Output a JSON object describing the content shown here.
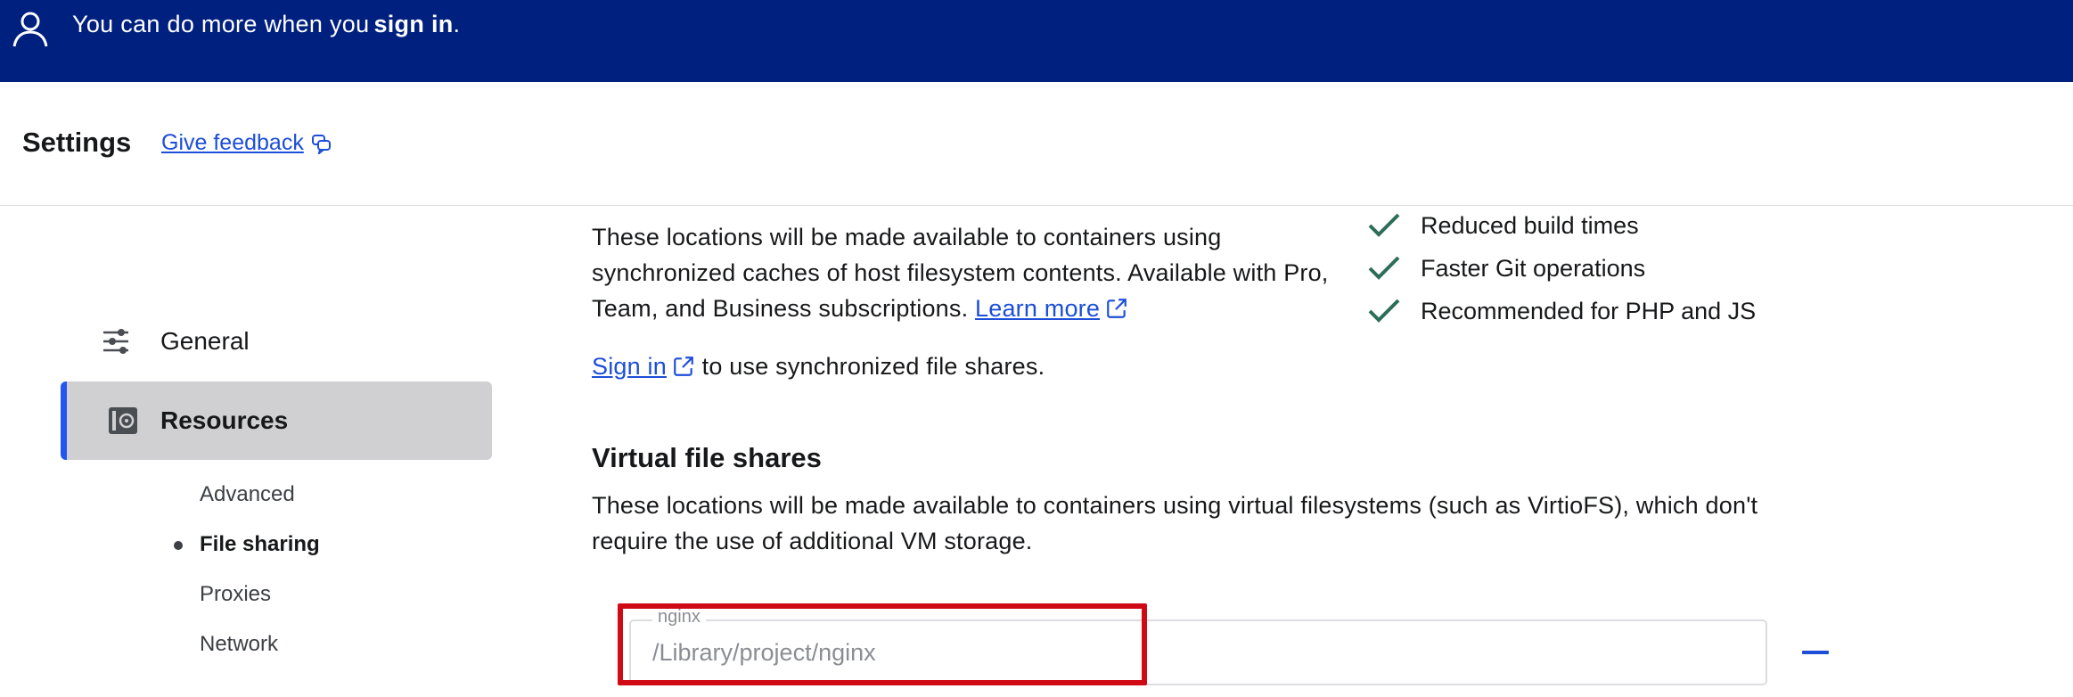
{
  "banner": {
    "message": "You can do more when you",
    "sign_in": "sign in",
    "suffix": "."
  },
  "header": {
    "title": "Settings",
    "feedback": "Give feedback"
  },
  "sidebar": {
    "items": [
      {
        "label": "General",
        "icon": "sliders-icon"
      },
      {
        "label": "Resources",
        "icon": "resources-icon",
        "active": true
      }
    ],
    "subitems": [
      {
        "label": "Advanced"
      },
      {
        "label": "File sharing",
        "active": true
      },
      {
        "label": "Proxies"
      },
      {
        "label": "Network"
      }
    ]
  },
  "synchronized": {
    "description": "These locations will be made available to containers using synchronized caches of host filesystem contents. Available with Pro, Team, and Business subscriptions.",
    "learn_more": "Learn more",
    "sign_in": "Sign in",
    "sign_in_suffix": "to use synchronized file shares.",
    "benefits": [
      "Reduced build times",
      "Faster Git operations",
      "Recommended for PHP and JS"
    ]
  },
  "virtual": {
    "title": "Virtual file shares",
    "description": "These locations will be made available to containers using virtual filesystems (such as VirtioFS), which don't require the use of additional VM storage.",
    "shares": [
      {
        "label": "nginx",
        "path": "/Library/project/nginx"
      }
    ]
  },
  "colors": {
    "banner_bg": "#00207f",
    "accent": "#2555f0",
    "link": "#1d4ed8",
    "check": "#2c6e5a",
    "highlight": "#cf0a14"
  }
}
